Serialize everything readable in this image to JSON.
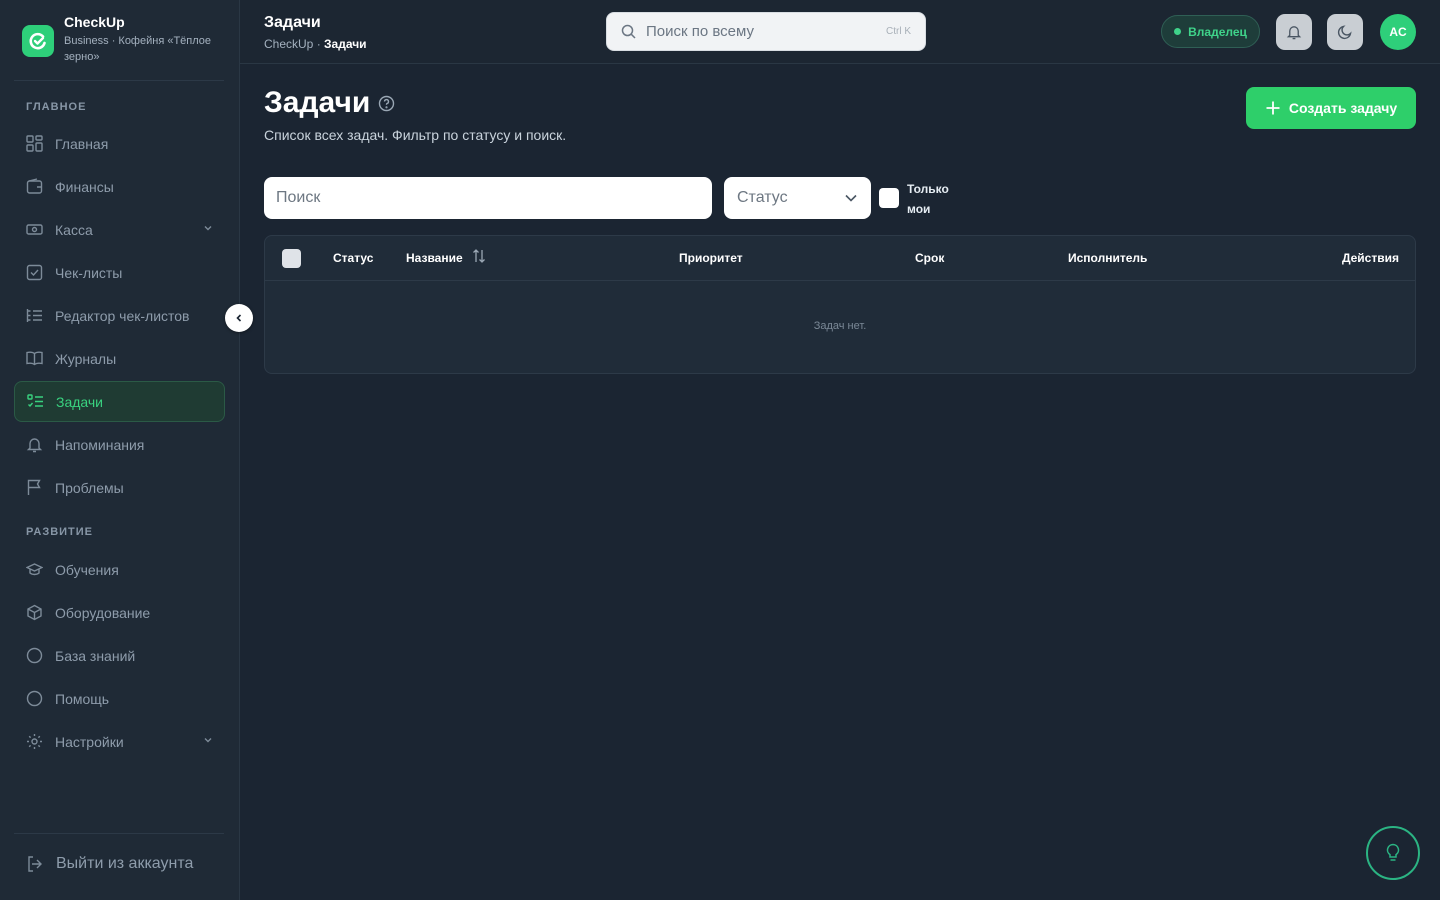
{
  "brand": {
    "name": "CheckUp",
    "subtitle": "Business · Кофейня «Тёплое зерно»"
  },
  "sidebar": {
    "sections": [
      {
        "title": "ГЛАВНОЕ",
        "items": [
          {
            "label": "Главная",
            "icon": "dashboard-icon"
          },
          {
            "label": "Финансы",
            "icon": "wallet-icon"
          },
          {
            "label": "Касса",
            "icon": "cash-icon",
            "expandable": true
          },
          {
            "label": "Чек-листы",
            "icon": "checklist-icon"
          },
          {
            "label": "Редактор чек-листов",
            "icon": "list-edit-icon"
          },
          {
            "label": "Журналы",
            "icon": "book-icon"
          },
          {
            "label": "Задачи",
            "icon": "tasks-icon",
            "active": true
          },
          {
            "label": "Напоминания",
            "icon": "bell-icon"
          },
          {
            "label": "Проблемы",
            "icon": "flag-icon"
          }
        ]
      },
      {
        "title": "РАЗВИТИЕ",
        "items": [
          {
            "label": "Обучения",
            "icon": "graduation-icon"
          },
          {
            "label": "Оборудование",
            "icon": "box-icon"
          },
          {
            "label": "База знаний",
            "icon": "circle-icon"
          },
          {
            "label": "Помощь",
            "icon": "circle-icon"
          },
          {
            "label": "Настройки",
            "icon": "gear-icon",
            "expandable": true
          }
        ]
      }
    ],
    "logout_label": "Выйти из аккаунта"
  },
  "header": {
    "title": "Задачи",
    "breadcrumb_root": "CheckUp · ",
    "breadcrumb_current": "Задачи",
    "search_placeholder": "Поиск по всему",
    "search_shortcut": "Ctrl K",
    "role_label": "Владелец",
    "avatar_initials": "AC"
  },
  "main": {
    "title": "Задачи",
    "description": "Список всех задач. Фильтр по статусу и поиск.",
    "create_button": "Создать задачу",
    "filters": {
      "search_placeholder": "Поиск",
      "status_placeholder": "Статус",
      "only_mine_label": "Только мои"
    },
    "table": {
      "columns": [
        "Статус",
        "Название",
        "Приоритет",
        "Срок",
        "Исполнитель",
        "Действия"
      ],
      "empty_text": "Задач нет."
    }
  },
  "colors": {
    "accent": "#2ecf6a",
    "background": "#1b2532",
    "sidebar": "#1f2a36",
    "active_nav_text": "#39d27f"
  }
}
